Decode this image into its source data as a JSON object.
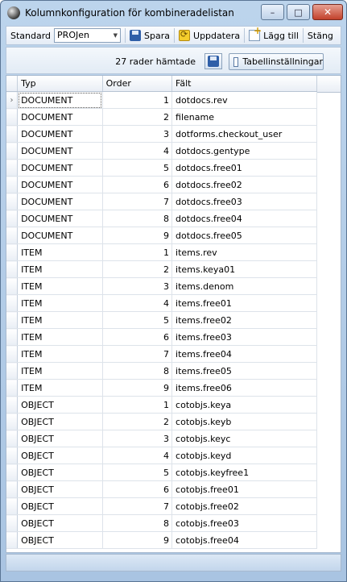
{
  "window": {
    "title": "Kolumnkonfiguration för kombineradelistan",
    "minimize_glyph": "–",
    "maximize_glyph": "□",
    "close_glyph": "✕"
  },
  "toolbar": {
    "standard_label": "Standard",
    "combo_value": "PROJen",
    "save_label": "Spara",
    "refresh_label": "Uppdatera",
    "add_label": "Lägg till",
    "close_label": "Stäng"
  },
  "status": {
    "rows_fetched": "27 rader hämtade",
    "table_settings_label": "Tabellinställningar"
  },
  "grid": {
    "columns": [
      "Typ",
      "Order",
      "Fält"
    ],
    "current_row_indicator": "›",
    "rows": [
      {
        "typ": "DOCUMENT",
        "order": "1",
        "falt": "dotdocs.rev"
      },
      {
        "typ": "DOCUMENT",
        "order": "2",
        "falt": "filename"
      },
      {
        "typ": "DOCUMENT",
        "order": "3",
        "falt": "dotforms.checkout_user"
      },
      {
        "typ": "DOCUMENT",
        "order": "4",
        "falt": "dotdocs.gentype"
      },
      {
        "typ": "DOCUMENT",
        "order": "5",
        "falt": "dotdocs.free01"
      },
      {
        "typ": "DOCUMENT",
        "order": "6",
        "falt": "dotdocs.free02"
      },
      {
        "typ": "DOCUMENT",
        "order": "7",
        "falt": "dotdocs.free03"
      },
      {
        "typ": "DOCUMENT",
        "order": "8",
        "falt": "dotdocs.free04"
      },
      {
        "typ": "DOCUMENT",
        "order": "9",
        "falt": "dotdocs.free05"
      },
      {
        "typ": "ITEM",
        "order": "1",
        "falt": "items.rev"
      },
      {
        "typ": "ITEM",
        "order": "2",
        "falt": "items.keya01"
      },
      {
        "typ": "ITEM",
        "order": "3",
        "falt": "items.denom"
      },
      {
        "typ": "ITEM",
        "order": "4",
        "falt": "items.free01"
      },
      {
        "typ": "ITEM",
        "order": "5",
        "falt": "items.free02"
      },
      {
        "typ": "ITEM",
        "order": "6",
        "falt": "items.free03"
      },
      {
        "typ": "ITEM",
        "order": "7",
        "falt": "items.free04"
      },
      {
        "typ": "ITEM",
        "order": "8",
        "falt": "items.free05"
      },
      {
        "typ": "ITEM",
        "order": "9",
        "falt": "items.free06"
      },
      {
        "typ": "OBJECT",
        "order": "1",
        "falt": "cotobjs.keya"
      },
      {
        "typ": "OBJECT",
        "order": "2",
        "falt": "cotobjs.keyb"
      },
      {
        "typ": "OBJECT",
        "order": "3",
        "falt": "cotobjs.keyc"
      },
      {
        "typ": "OBJECT",
        "order": "4",
        "falt": "cotobjs.keyd"
      },
      {
        "typ": "OBJECT",
        "order": "5",
        "falt": "cotobjs.keyfree1"
      },
      {
        "typ": "OBJECT",
        "order": "6",
        "falt": "cotobjs.free01"
      },
      {
        "typ": "OBJECT",
        "order": "7",
        "falt": "cotobjs.free02"
      },
      {
        "typ": "OBJECT",
        "order": "8",
        "falt": "cotobjs.free03"
      },
      {
        "typ": "OBJECT",
        "order": "9",
        "falt": "cotobjs.free04"
      }
    ]
  }
}
